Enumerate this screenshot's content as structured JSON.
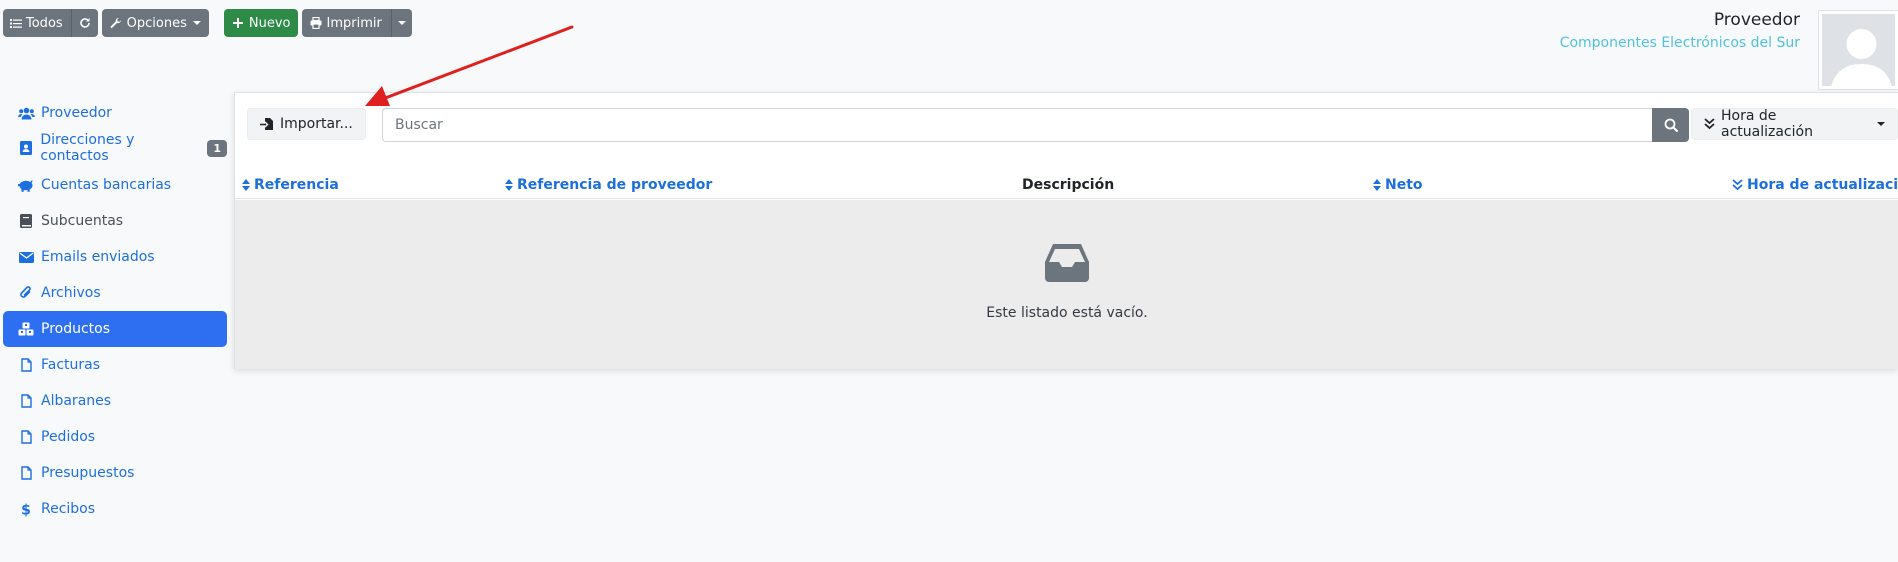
{
  "toolbar": {
    "all_label": "Todos",
    "options_label": "Opciones",
    "new_label": "Nuevo",
    "print_label": "Imprimir"
  },
  "header": {
    "title": "Proveedor",
    "subtitle": "Componentes Electrónicos del Sur"
  },
  "sidebar": {
    "items": [
      {
        "label": "Proveedor",
        "icon": "users-icon"
      },
      {
        "label": "Direcciones y contactos",
        "icon": "address-book-icon",
        "badge": "1"
      },
      {
        "label": "Cuentas bancarias",
        "icon": "piggy-bank-icon"
      },
      {
        "label": "Subcuentas",
        "icon": "book-icon"
      },
      {
        "label": "Emails enviados",
        "icon": "envelope-icon"
      },
      {
        "label": "Archivos",
        "icon": "paperclip-icon"
      },
      {
        "label": "Productos",
        "icon": "cubes-icon",
        "active": true
      },
      {
        "label": "Facturas",
        "icon": "file-icon"
      },
      {
        "label": "Albaranes",
        "icon": "file-icon"
      },
      {
        "label": "Pedidos",
        "icon": "file-icon"
      },
      {
        "label": "Presupuestos",
        "icon": "file-icon"
      },
      {
        "label": "Recibos",
        "icon": "dollar-icon"
      }
    ]
  },
  "main": {
    "import_label": "Importar...",
    "search_placeholder": "Buscar",
    "sort_label": "Hora de actualización",
    "columns": [
      "Referencia",
      "Referencia de proveedor",
      "Descripción",
      "Neto",
      "Hora de actualización"
    ],
    "empty_text": "Este listado está vacío."
  },
  "colors": {
    "accent": "#1d6fe0",
    "active_bg": "#2d6ff0",
    "success": "#2e8b47",
    "secondary": "#6c757d",
    "annotation_arrow": "#e02020"
  }
}
